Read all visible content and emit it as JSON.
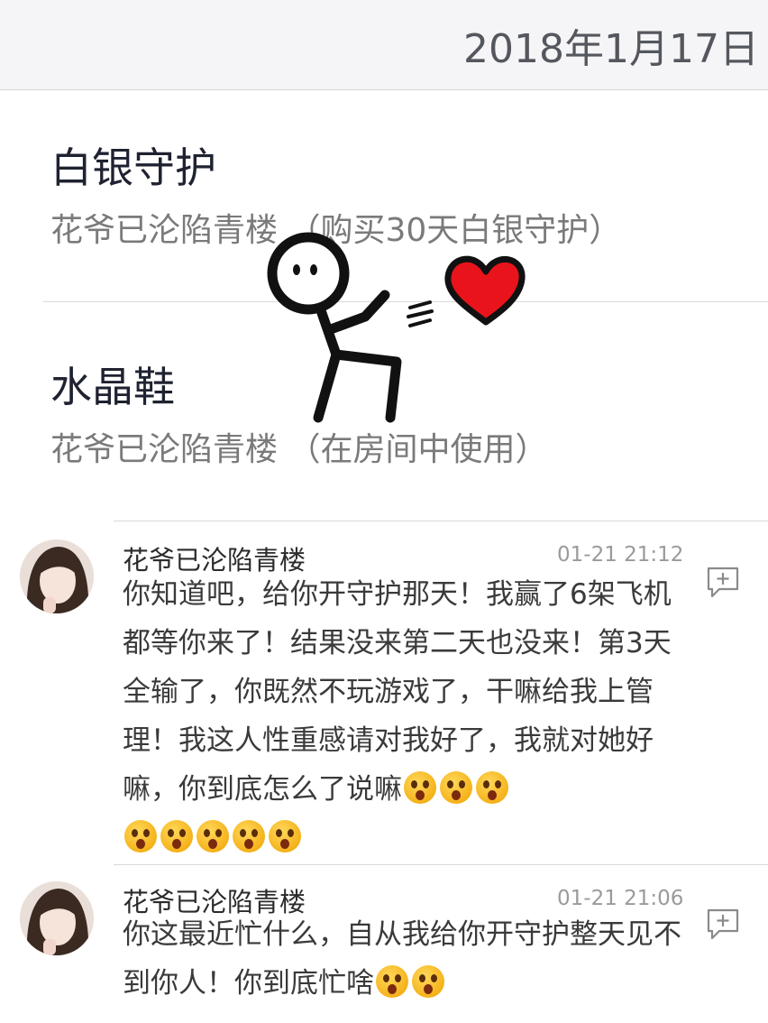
{
  "header": {
    "date": "2018年1月17日"
  },
  "gifts": [
    {
      "title": "白银守护",
      "desc": "花爷已沦陷青楼 （购买30天白银守护）"
    },
    {
      "title": "水晶鞋",
      "desc": "花爷已沦陷青楼 （在房间中使用）"
    }
  ],
  "comments": [
    {
      "author": "花爷已沦陷青楼",
      "time": "01-21 21:12",
      "text": "你知道吧，给你开守护那天！我赢了6架飞机都等你来了！结果没来第二天也没来！第3天全输了，你既然不玩游戏了，干嘛给我上管理！我这人性重感请对我好了，我就对她好嘛，你到底怎么了说嘛",
      "emoji_count": 8
    },
    {
      "author": "花爷已沦陷青楼",
      "time": "01-21 21:06",
      "text": "你这最近忙什么，自从我给你开守护整天见不到你人！你到底忙啥",
      "emoji_count": 2
    }
  ],
  "colors": {
    "heart": "#e8131b",
    "text_dark": "#1f2230",
    "text_gray": "#7a7a7a"
  },
  "icons": [
    "stickman-sticker",
    "heart-icon",
    "avatar",
    "reply-comment-icon",
    "shocked-emoji"
  ]
}
